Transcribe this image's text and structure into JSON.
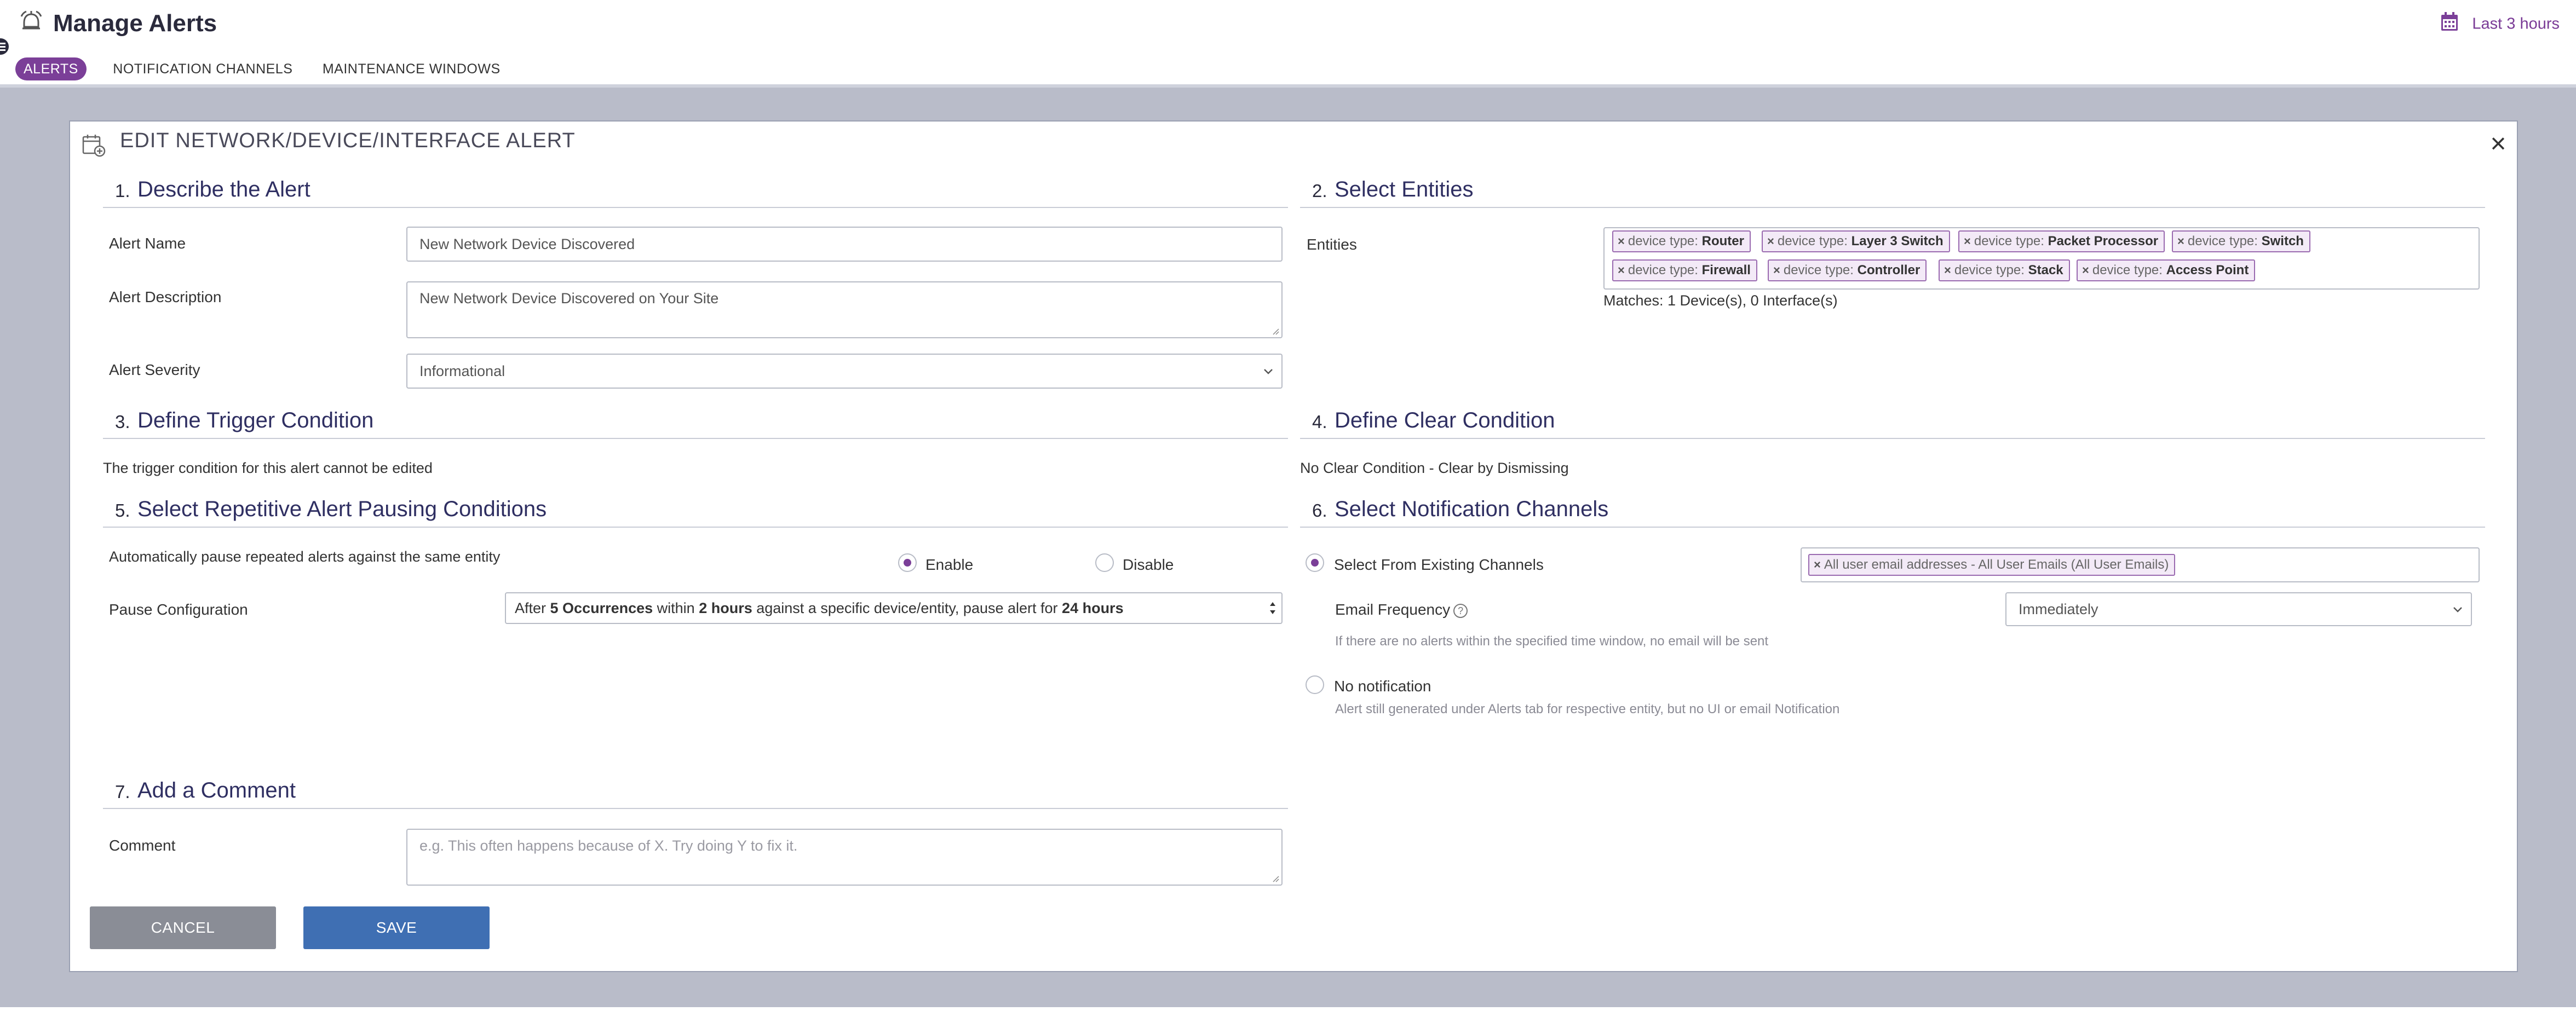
{
  "header": {
    "title": "Manage Alerts",
    "time_range": "Last 3 hours",
    "tabs": [
      {
        "label": "ALERTS",
        "active": true
      },
      {
        "label": "NOTIFICATION CHANNELS",
        "active": false
      },
      {
        "label": "MAINTENANCE WINDOWS",
        "active": false
      }
    ]
  },
  "modal": {
    "title": "EDIT NETWORK/DEVICE/INTERFACE ALERT",
    "close": "×",
    "sections": {
      "s1": {
        "num": "1.",
        "title": "Describe the Alert"
      },
      "s2": {
        "num": "2.",
        "title": "Select Entities"
      },
      "s3": {
        "num": "3.",
        "title": "Define Trigger Condition"
      },
      "s4": {
        "num": "4.",
        "title": "Define Clear Condition"
      },
      "s5": {
        "num": "5.",
        "title": "Select Repetitive Alert Pausing Conditions"
      },
      "s6": {
        "num": "6.",
        "title": "Select Notification Channels"
      },
      "s7": {
        "num": "7.",
        "title": "Add a Comment"
      }
    },
    "describe": {
      "name_label": "Alert Name",
      "name_value": "New Network Device Discovered",
      "desc_label": "Alert Description",
      "desc_value": "New Network Device Discovered on Your Site",
      "severity_label": "Alert Severity",
      "severity_value": "Informational"
    },
    "entities": {
      "label": "Entities",
      "chip_prefix": "device type:",
      "chips": [
        "Router",
        "Layer 3 Switch",
        "Packet Processor",
        "Switch",
        "Firewall",
        "Controller",
        "Stack",
        "Access Point"
      ],
      "matches": "Matches: 1 Device(s), 0 Interface(s)"
    },
    "trigger": {
      "text": "The trigger condition for this alert cannot be edited"
    },
    "clear": {
      "text": "No Clear Condition - Clear by Dismissing"
    },
    "pausing": {
      "auto_label": "Automatically pause repeated alerts against the same entity",
      "enable_label": "Enable",
      "disable_label": "Disable",
      "selected": "Enable",
      "config_label": "Pause Configuration",
      "config": {
        "t1": "After ",
        "occurrences": "5 Occurrences",
        "t2": " within ",
        "window": "2 hours",
        "t3": " against a specific device/entity, pause alert for ",
        "pause": "24 hours"
      }
    },
    "notification": {
      "existing_label": "Select From Existing Channels",
      "channel_chip": "All user email addresses - All User Emails (All User Emails)",
      "freq_label": "Email Frequency",
      "freq_value": "Immediately",
      "freq_hint": "If there are no alerts within the specified time window, no email will be sent",
      "none_label": "No notification",
      "none_hint": "Alert still generated under Alerts tab for respective entity, but no UI or email Notification",
      "selected": "existing"
    },
    "comment": {
      "label": "Comment",
      "placeholder": "e.g. This often happens because of X. Try doing Y to fix it."
    },
    "buttons": {
      "cancel": "CANCEL",
      "save": "SAVE"
    }
  },
  "colors": {
    "accent": "#7b3f98",
    "save": "#3f6fb3",
    "cancel": "#8a8d96",
    "section_title": "#2f2f62",
    "backdrop": "#b9bcc9"
  }
}
